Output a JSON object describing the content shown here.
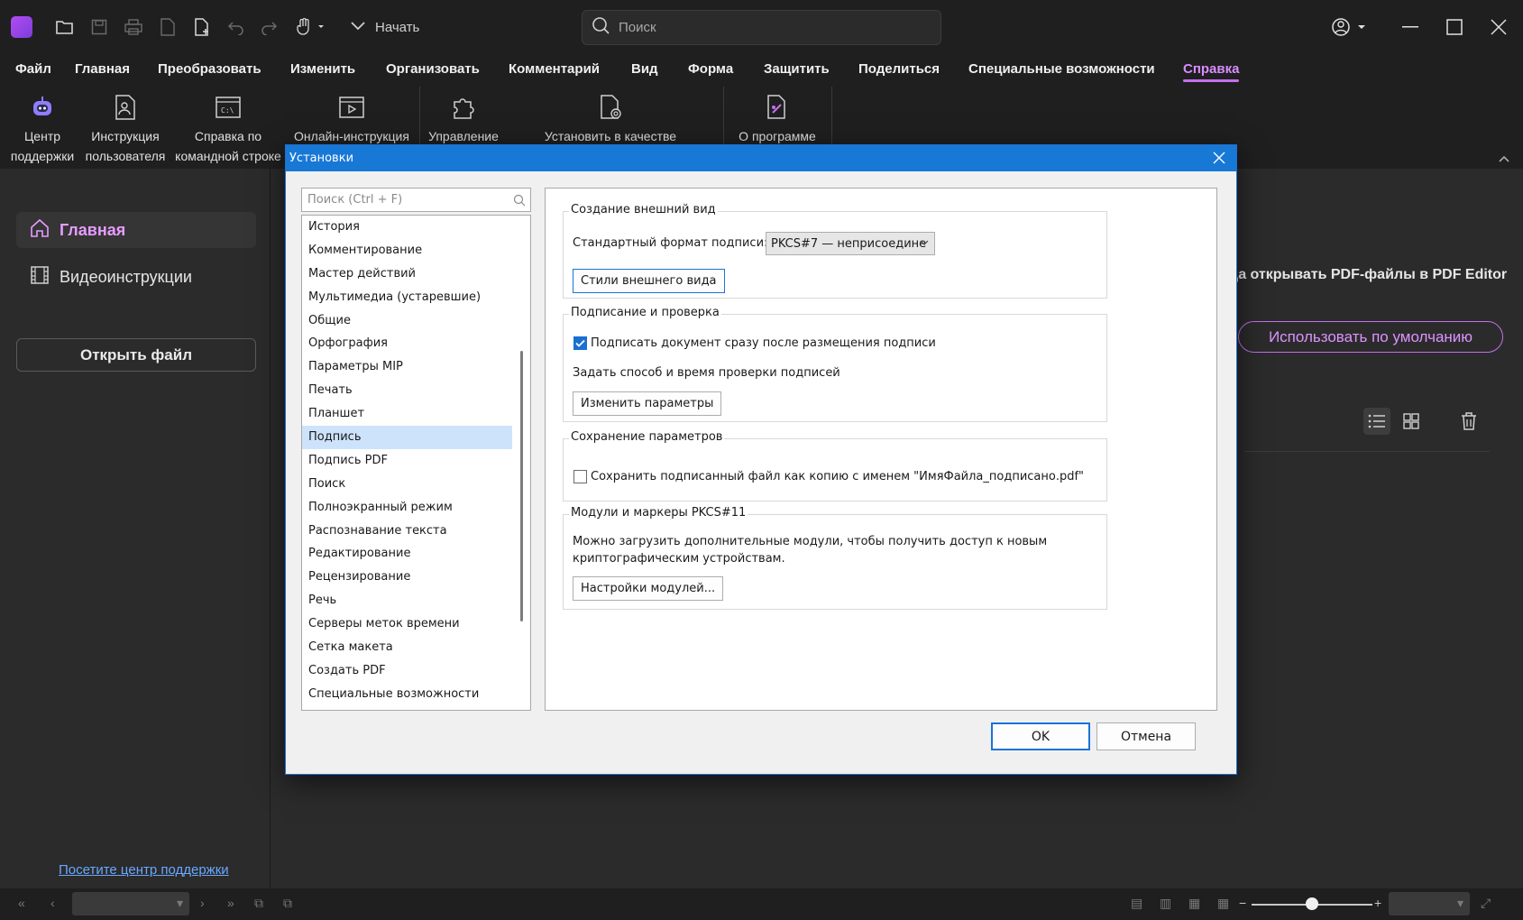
{
  "toolbar": {
    "start_label": "Начать",
    "search_placeholder": "Поиск"
  },
  "menu": [
    "Файл",
    "Главная",
    "Преобразовать",
    "Изменить",
    "Организовать",
    "Комментарий",
    "Вид",
    "Форма",
    "Защитить",
    "Поделиться",
    "Специальные возможности",
    "Справка"
  ],
  "menu_active": "Справка",
  "ribbon": {
    "support_center": [
      "Центр",
      "поддержки"
    ],
    "user_guide": [
      "Инструкция",
      "пользователя"
    ],
    "cmd_help": [
      "Справка по",
      "командной строке"
    ],
    "online_guide": [
      "Онлайн-инструкция"
    ],
    "manage": [
      "Управление"
    ],
    "set_default": [
      "Установить в качестве"
    ],
    "about": [
      "О программе"
    ]
  },
  "sidebar": {
    "home": "Главная",
    "videos": "Видеоинструкции",
    "open_file": "Открыть файл",
    "support_link": "Посетите центр поддержки"
  },
  "main": {
    "default_text": "гда открывать PDF-файлы в PDF Editor",
    "default_button": "Использовать по умолчанию"
  },
  "dialog": {
    "title": "Установки",
    "search_placeholder": "Поиск (Ctrl + F)",
    "categories": [
      "История",
      "Комментирование",
      "Мастер действий",
      "Мультимедиа (устаревшие)",
      "Общие",
      "Орфография",
      "Параметры MIP",
      "Печать",
      "Планшет",
      "Подпись",
      "Подпись PDF",
      "Поиск",
      "Полноэкранный режим",
      "Распознавание текста",
      "Редактирование",
      "Рецензирование",
      "Речь",
      "Серверы меток времени",
      "Сетка макета",
      "Создать PDF",
      "Специальные возможности"
    ],
    "selected_category": "Подпись",
    "group1": {
      "title": "Создание  внешний вид",
      "format_label": "Стандартный формат подписи:",
      "format_value": "PKCS#7 — неприсоедине",
      "styles_button": "Стили внешнего вида"
    },
    "group2": {
      "title": "Подписание и проверка",
      "sign_checkbox": "Подписать документ сразу после размещения подписи",
      "sign_checked": true,
      "verify_text": "Задать способ и время проверки подписей",
      "change_button": "Изменить параметры"
    },
    "group3": {
      "title": "Сохранение параметров",
      "save_checkbox": "Сохранить подписанный файл как копию с именем \"ИмяФайла_подписано.pdf\"",
      "save_checked": false
    },
    "group4": {
      "title": "Модули и маркеры PKCS#11",
      "desc_line1": "Можно загрузить дополнительные модули, чтобы получить доступ к новым",
      "desc_line2": "криптографическим устройствам.",
      "modules_button": "Настройки модулей..."
    },
    "ok": "OK",
    "cancel": "Отмена"
  },
  "colors": {
    "accent": "#c56ff0",
    "dialog_title": "#1878d6",
    "selection": "#cde3fb"
  }
}
